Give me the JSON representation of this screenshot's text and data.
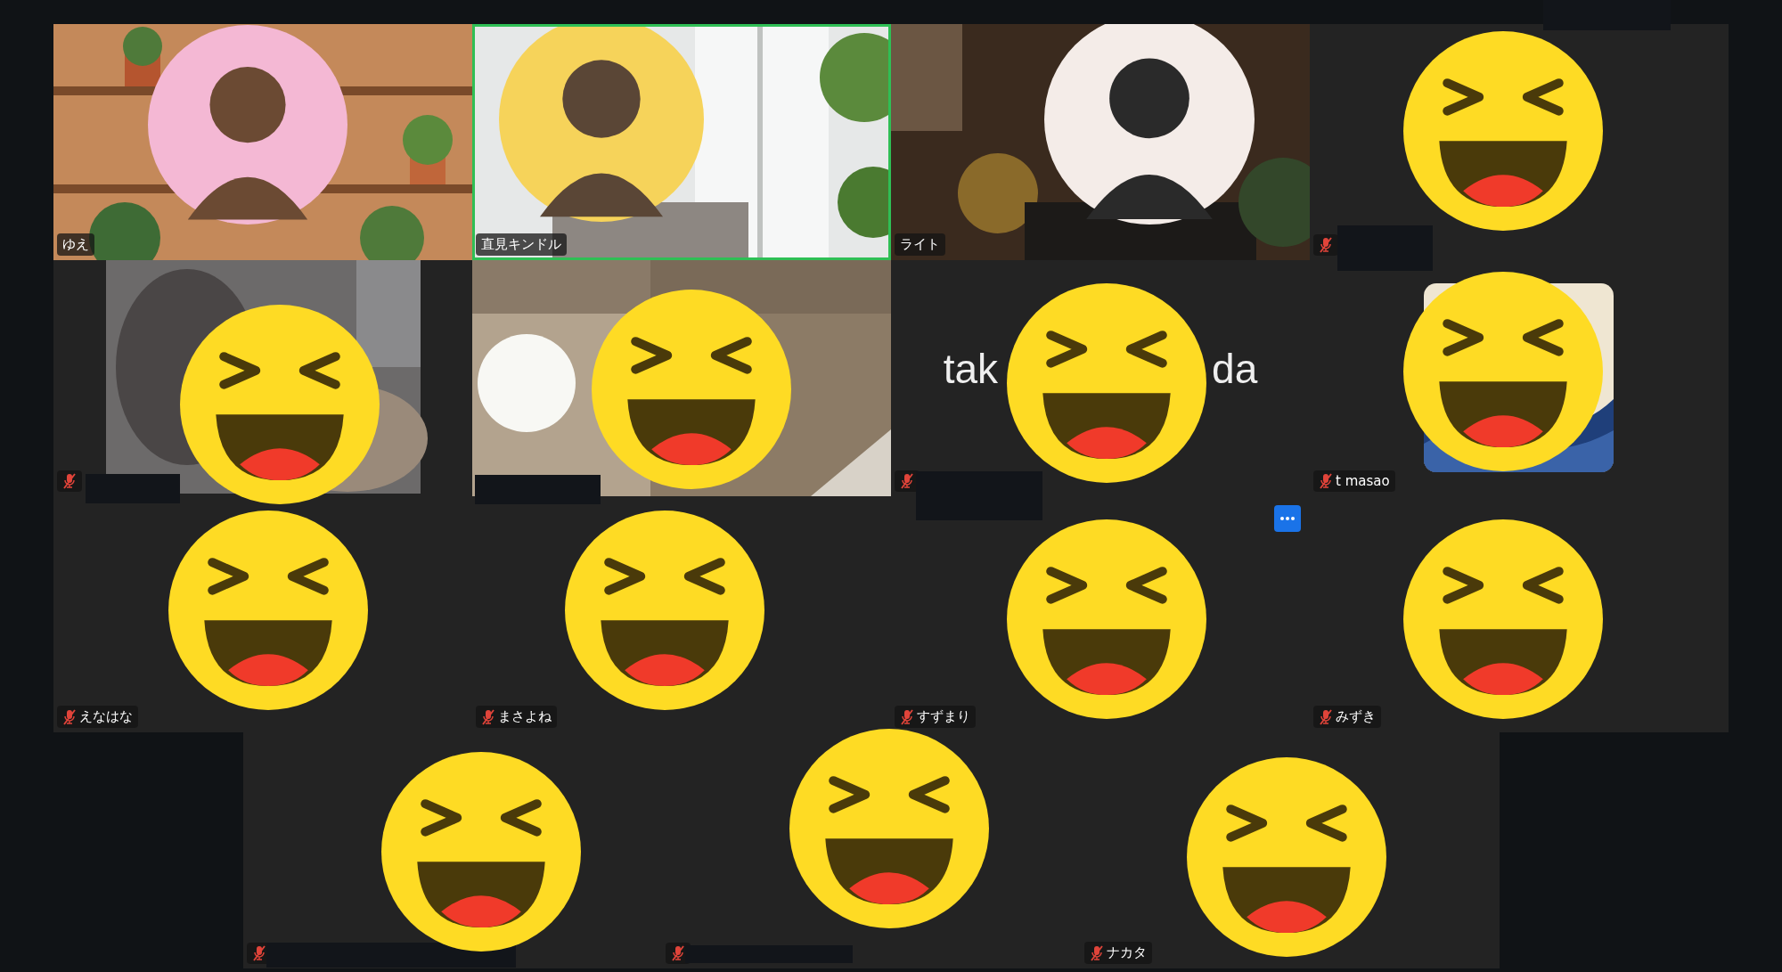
{
  "gallery": {
    "rows": [
      {
        "tiles": [
          {
            "kind": "video",
            "name": "ゆえ",
            "muted": false,
            "speaking": false,
            "reaction": false
          },
          {
            "kind": "video",
            "name": "直見キンドル",
            "muted": false,
            "speaking": true,
            "reaction": false
          },
          {
            "kind": "video",
            "name": "ライト",
            "muted": false,
            "speaking": false,
            "reaction": false
          },
          {
            "kind": "blank",
            "muted": true,
            "speaking": false,
            "reaction": true
          }
        ]
      },
      {
        "tiles": [
          {
            "kind": "video",
            "muted": true,
            "speaking": false,
            "reaction": true
          },
          {
            "kind": "video",
            "muted": false,
            "speaking": false,
            "reaction": true
          },
          {
            "kind": "name_card",
            "big_text": [
              "tak",
              "da"
            ],
            "muted": true,
            "speaking": false,
            "reaction": true
          },
          {
            "kind": "avatar",
            "name": "t masao",
            "muted": true,
            "speaking": false,
            "reaction": true
          }
        ]
      },
      {
        "tiles": [
          {
            "kind": "blank",
            "name": "えなはな",
            "muted": true,
            "speaking": false,
            "reaction": true
          },
          {
            "kind": "blank",
            "name": "まさよね",
            "muted": true,
            "speaking": false,
            "reaction": true
          },
          {
            "kind": "blank",
            "name": "すずまり",
            "muted": true,
            "speaking": false,
            "reaction": true,
            "menu": true
          },
          {
            "kind": "blank",
            "name": "みずき",
            "muted": true,
            "speaking": false,
            "reaction": true
          }
        ]
      },
      {
        "tiles": [
          {
            "kind": "blank",
            "muted": true,
            "speaking": false,
            "reaction": true
          },
          {
            "kind": "blank",
            "muted": true,
            "speaking": false,
            "reaction": true
          },
          {
            "kind": "blank",
            "name": "ナカタ",
            "muted": true,
            "speaking": false,
            "reaction": true
          }
        ]
      }
    ]
  }
}
